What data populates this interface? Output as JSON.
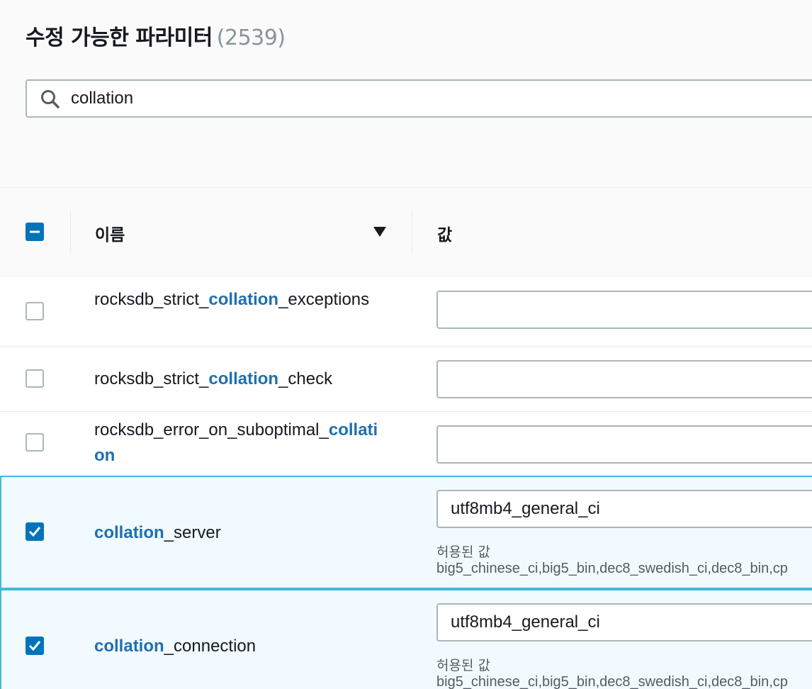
{
  "header": {
    "title": "수정 가능한 파라미터",
    "count": "(2539)"
  },
  "search": {
    "value": "collation",
    "icon": "search-icon"
  },
  "table": {
    "columns": {
      "name": "이름",
      "value": "값"
    },
    "rows": [
      {
        "name_pre": "rocksdb_strict_",
        "name_hl": "collation",
        "name_post": "_exceptions",
        "value": "",
        "selected": false
      },
      {
        "name_pre": "rocksdb_strict_",
        "name_hl": "collation",
        "name_post": "_check",
        "value": "",
        "selected": false
      },
      {
        "name_pre": "rocksdb_error_on_suboptimal_",
        "name_hl": "collation",
        "name_post": "",
        "value": "",
        "selected": false
      },
      {
        "name_pre": "",
        "name_hl": "collation",
        "name_post": "_server",
        "value": "utf8mb4_general_ci",
        "selected": true,
        "allowed_label": "허용된 값",
        "allowed_values": "big5_chinese_ci,big5_bin,dec8_swedish_ci,dec8_bin,cp"
      },
      {
        "name_pre": "",
        "name_hl": "collation",
        "name_post": "_connection",
        "value": "utf8mb4_general_ci",
        "selected": true,
        "allowed_label": "허용된 값",
        "allowed_values": "big5_chinese_ci,big5_bin,dec8_swedish_ci,dec8_bin,cp"
      }
    ]
  },
  "colors": {
    "accent": "#0073bb",
    "highlight_text": "#1f6fb0",
    "selected_row_bg": "#f1faff",
    "selected_row_border": "#44b9d6"
  }
}
